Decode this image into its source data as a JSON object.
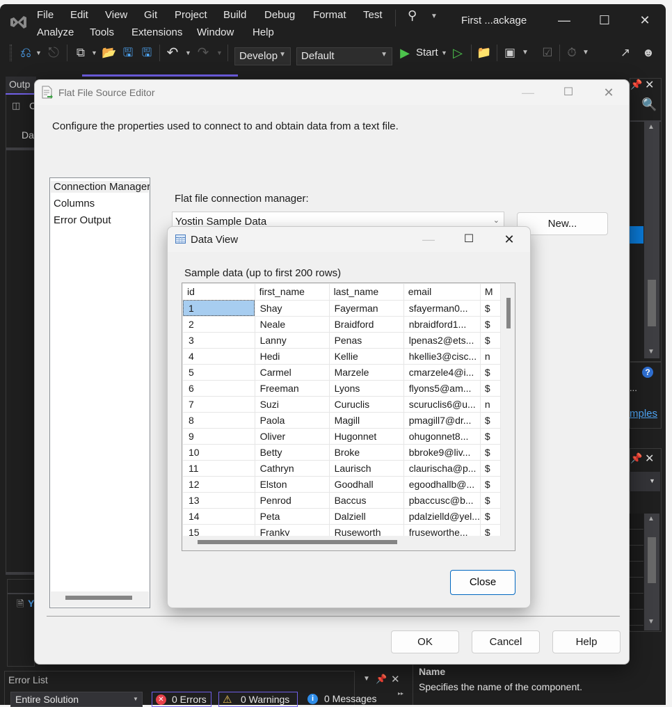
{
  "vs": {
    "title": "First ...ackage",
    "menu_row1": [
      "File",
      "Edit",
      "View",
      "Git",
      "Project",
      "Build",
      "Debug",
      "Format",
      "Test"
    ],
    "menu_row2": [
      "Analyze",
      "Tools",
      "Extensions",
      "Window",
      "Help"
    ],
    "toolbar": {
      "config_combo": "Develop",
      "platform_combo": "Default",
      "start_label": "Start"
    },
    "left_panel": {
      "tab_label": "Outp",
      "row_label": "C",
      "row2_label": "Da",
      "bottom_label": "Y"
    },
    "right_panel": {
      "link_text": "mples",
      "ellipsis": "..."
    },
    "properties_help": {
      "title": "Name",
      "description": "Specifies the name of the component."
    },
    "error_list": {
      "title": "Error List",
      "scope": "Entire Solution",
      "errors": "0 Errors",
      "warnings": "0 Warnings",
      "messages": "0 Messages"
    }
  },
  "ffse": {
    "title": "Flat File Source Editor",
    "description": "Configure the properties used to connect to and obtain data from a text file.",
    "nav_items": [
      "Connection Manager",
      "Columns",
      "Error Output"
    ],
    "connection_label": "Flat file connection manager:",
    "connection_value": "Yostin Sample Data",
    "new_button": "New...",
    "ok_button": "OK",
    "cancel_button": "Cancel",
    "help_button": "Help"
  },
  "data_view": {
    "title": "Data View",
    "sample_label": "Sample data (up to first 200 rows)",
    "columns": [
      "id",
      "first_name",
      "last_name",
      "email",
      "M"
    ],
    "rows": [
      [
        "1",
        "Shay",
        "Fayerman",
        "sfayerman0...",
        "$"
      ],
      [
        "2",
        "Neale",
        "Braidford",
        "nbraidford1...",
        "$"
      ],
      [
        "3",
        "Lanny",
        "Penas",
        "lpenas2@ets...",
        "$"
      ],
      [
        "4",
        "Hedi",
        "Kellie",
        "hkellie3@cisc...",
        "n"
      ],
      [
        "5",
        "Carmel",
        "Marzele",
        "cmarzele4@i...",
        "$"
      ],
      [
        "6",
        "Freeman",
        "Lyons",
        "flyons5@am...",
        "$"
      ],
      [
        "7",
        "Suzi",
        "Curuclis",
        "scuruclis6@u...",
        "n"
      ],
      [
        "8",
        "Paola",
        "Magill",
        "pmagill7@dr...",
        "$"
      ],
      [
        "9",
        "Oliver",
        "Hugonnet",
        "ohugonnet8...",
        "$"
      ],
      [
        "10",
        "Betty",
        "Broke",
        "bbroke9@liv...",
        "$"
      ],
      [
        "11",
        "Cathryn",
        "Laurisch",
        "claurischa@p...",
        "$"
      ],
      [
        "12",
        "Elston",
        "Goodhall",
        "egoodhallb@...",
        "$"
      ],
      [
        "13",
        "Penrod",
        "Baccus",
        "pbaccusc@b...",
        "$"
      ],
      [
        "14",
        "Peta",
        "Dalziell",
        "pdalzielld@yel...",
        "$"
      ],
      [
        "15",
        "Franky",
        "Ruseworth",
        "fruseworthe...",
        "$"
      ]
    ],
    "close_button": "Close"
  }
}
